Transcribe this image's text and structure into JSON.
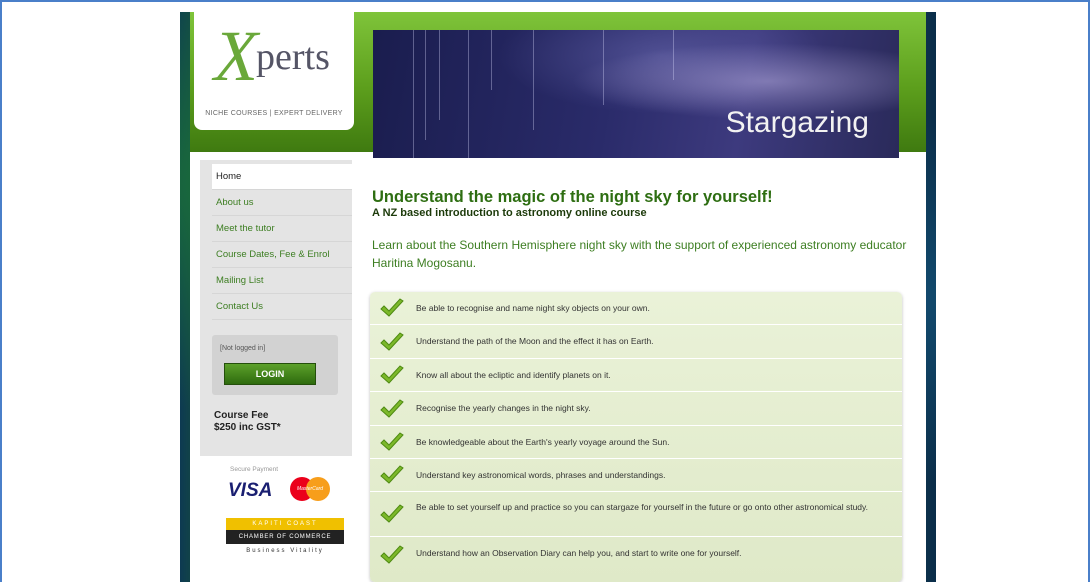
{
  "logo": {
    "x": "X",
    "rest": "perts",
    "tagline": "NICHE COURSES | EXPERT DELIVERY"
  },
  "banner": {
    "title": "Stargazing"
  },
  "nav": {
    "items": [
      {
        "label": "Home"
      },
      {
        "label": "About us"
      },
      {
        "label": "Meet the tutor"
      },
      {
        "label": "Course Dates, Fee & Enrol"
      },
      {
        "label": "Mailing List"
      },
      {
        "label": "Contact Us"
      }
    ]
  },
  "login": {
    "status": "[Not logged in]",
    "button_label": "LOGIN"
  },
  "fee": {
    "line1": "Course Fee",
    "line2": "$250 inc GST*"
  },
  "payment": {
    "secure": "Secure Payment",
    "visa": "VISA",
    "mastercard": "MasterCard"
  },
  "chamber": {
    "line1": "KAPITI COAST",
    "line2": "CHAMBER OF COMMERCE",
    "line3": "Business Vitality"
  },
  "content": {
    "heading": "Understand the magic of the night sky for yourself!",
    "subheading": "A NZ based introduction to astronomy online course",
    "intro": "Learn about the Southern Hemisphere night sky with the support of experienced astronomy educator Haritina Mogosanu."
  },
  "objectives": [
    "Be able to recognise and name night sky objects on your own.",
    "Understand the path of the Moon and the effect it has on Earth.",
    "Know all about the ecliptic and identify planets on it.",
    "Recognise the yearly changes in the night sky.",
    "Be knowledgeable about the Earth's yearly voyage around the Sun.",
    "Understand key astronomical words, phrases and understandings.",
    "Be able to set yourself up and practice so you can stargaze for yourself in the future or go onto other astronomical study.",
    "Understand how an Observation Diary can help you, and start to write one for yourself."
  ],
  "colors": {
    "accent_green": "#3d7e22",
    "header_green": "#6aa83a",
    "window_border": "#4a7fc9"
  }
}
